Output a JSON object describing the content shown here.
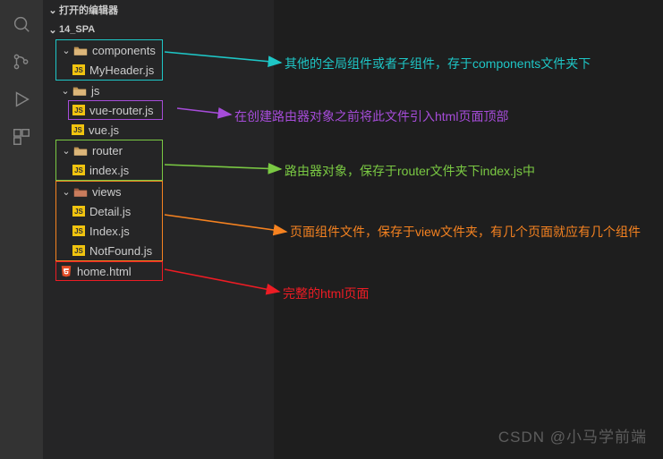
{
  "sections": {
    "open_editors": "打开的编辑器",
    "project": "14_SPA"
  },
  "tree": {
    "components": {
      "folder": "components",
      "file": "MyHeader.js"
    },
    "js": {
      "folder": "js",
      "files": [
        "vue-router.js",
        "vue.js"
      ]
    },
    "router": {
      "folder": "router",
      "file": "index.js"
    },
    "views": {
      "folder": "views",
      "files": [
        "Detail.js",
        "Index.js",
        "NotFound.js"
      ]
    },
    "root_file": "home.html"
  },
  "js_badge": "JS",
  "annotations": {
    "teal": "其他的全局组件或者子组件，存于components文件夹下",
    "purple": "在创建路由器对象之前将此文件引入html页面顶部",
    "green": "路由器对象，保存于router文件夹下index.js中",
    "orange": "页面组件文件，保存于view文件夹，有几个页面就应有几个组件",
    "red": "完整的html页面"
  },
  "arrows": {
    "teal": ">",
    "green": ">",
    "orange": ">",
    "red": ">",
    "purple": ">"
  },
  "watermark": "CSDN @小马学前端",
  "colors": {
    "teal": "#1ec6c6",
    "purple": "#a64cd9",
    "green": "#7ac943",
    "orange": "#f58220",
    "red": "#ed1c24",
    "js_bg": "#f1c40f",
    "html": "#e44d26"
  }
}
